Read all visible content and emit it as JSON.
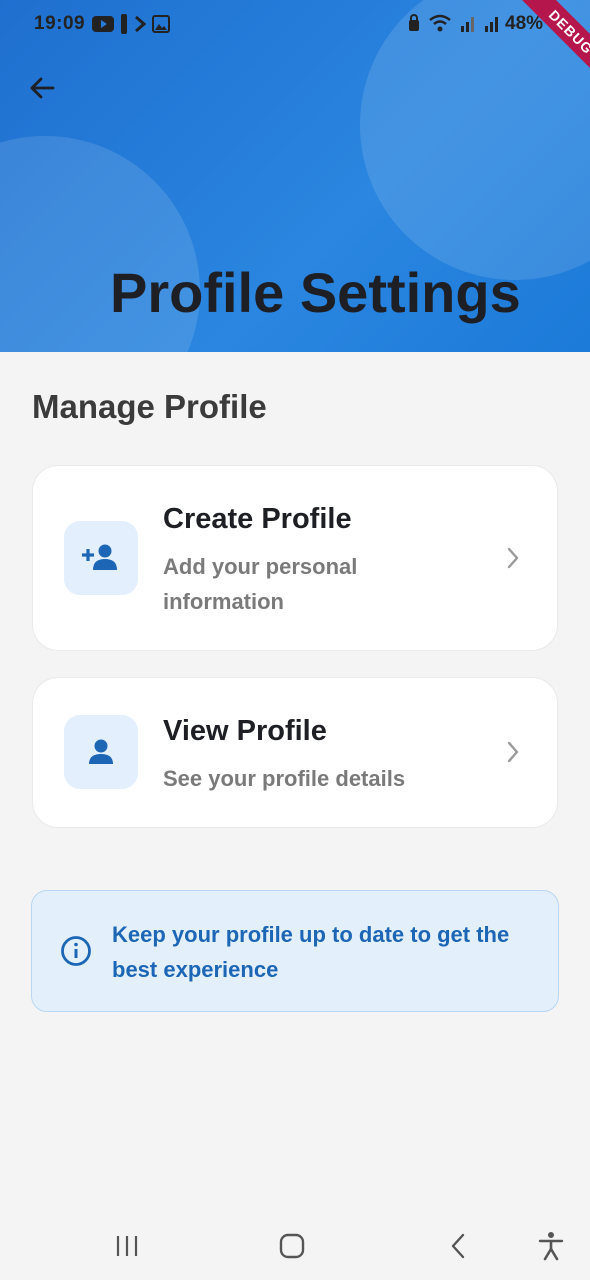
{
  "status_bar": {
    "time": "19:09",
    "battery": "48%",
    "icons_left": [
      "youtube-icon",
      "notification-icon",
      "play-icon",
      "image-icon"
    ],
    "icons_right": [
      "lock-icon",
      "wifi-icon",
      "signal-icon",
      "signal-icon"
    ]
  },
  "debug_banner": "DEBUG",
  "header": {
    "title": "Profile Settings",
    "accent_color": "#1f6fcf"
  },
  "section": {
    "title": "Manage Profile"
  },
  "cards": [
    {
      "title": "Create Profile",
      "subtitle": "Add your personal information",
      "icon": "person-add-icon"
    },
    {
      "title": "View Profile",
      "subtitle": "See your profile details",
      "icon": "person-icon"
    }
  ],
  "info": {
    "text": "Keep your profile up to date to get the best experience",
    "icon": "info-icon",
    "color": "#1c66b5"
  },
  "nav_bar": {
    "buttons": [
      "recents-icon",
      "home-icon",
      "back-icon",
      "accessibility-icon"
    ]
  }
}
